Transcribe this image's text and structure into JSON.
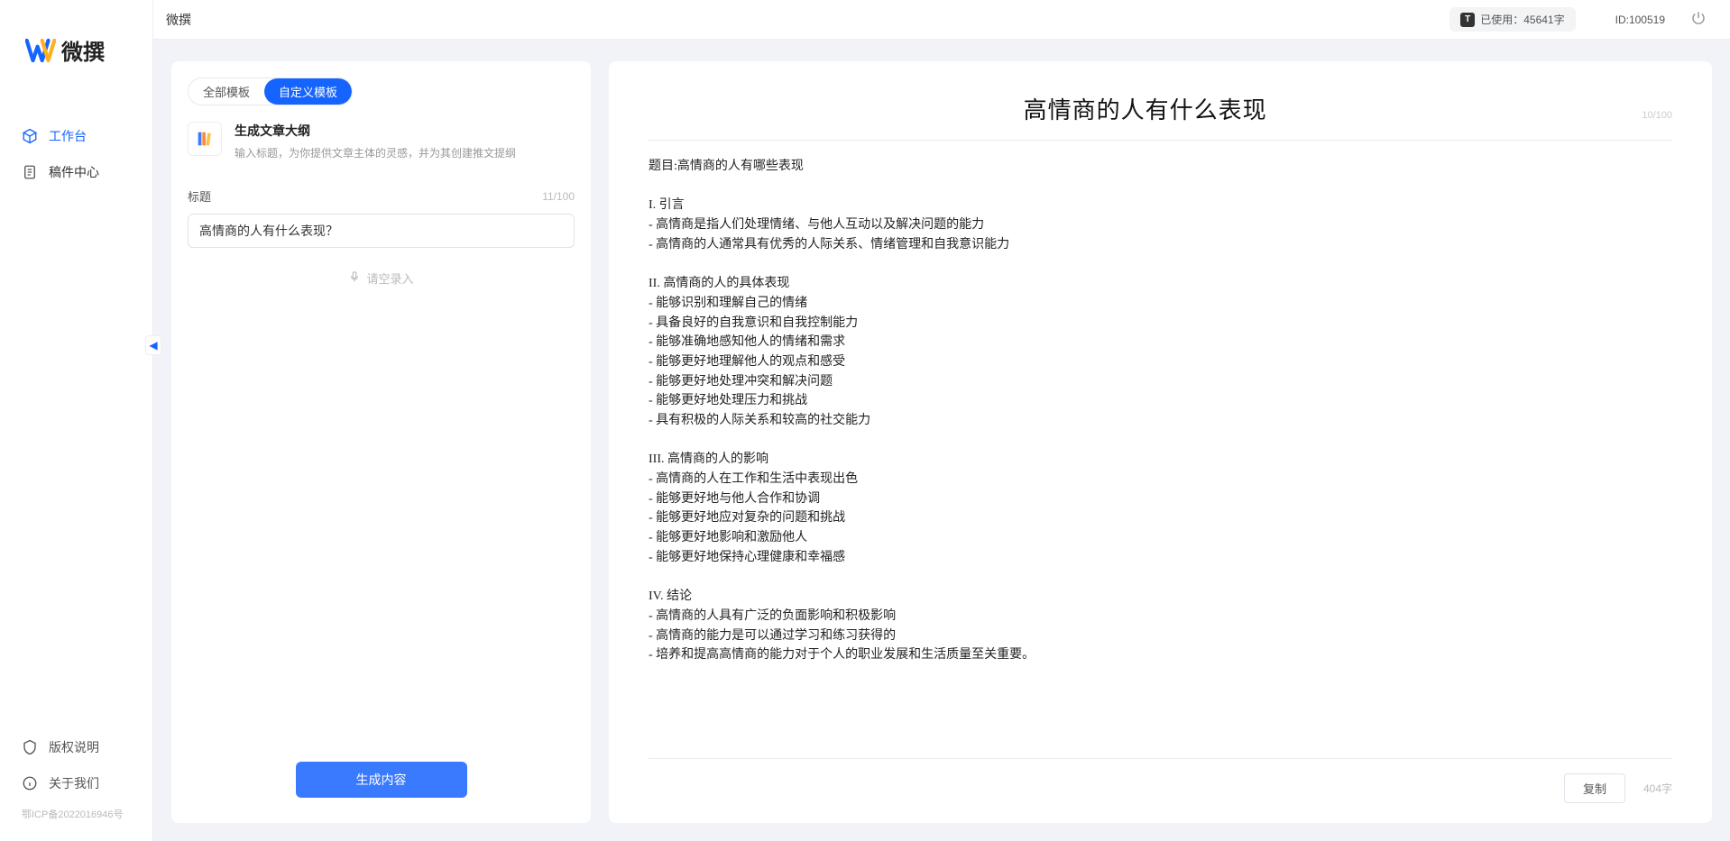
{
  "brand": {
    "name": "微撰"
  },
  "topbar": {
    "app_name": "微撰",
    "usage_label": "已使用：45641字",
    "user_id": "ID:100519"
  },
  "sidebar": {
    "nav": [
      {
        "key": "workbench",
        "label": "工作台",
        "active": true
      },
      {
        "key": "drafts",
        "label": "稿件中心",
        "active": false
      }
    ],
    "bottom": [
      {
        "key": "copyright",
        "label": "版权说明"
      },
      {
        "key": "about",
        "label": "关于我们"
      }
    ],
    "icp": "鄂ICP备2022016946号"
  },
  "tabs": {
    "all": "全部模板",
    "custom": "自定义模板"
  },
  "template": {
    "title": "生成文章大纲",
    "desc": "输入标题，为你提供文章主体的灵感，并为其创建推文提纲"
  },
  "form": {
    "title_label": "标题",
    "title_value": "高情商的人有什么表现？",
    "title_count": "11/100",
    "voice_hint": "请空录入"
  },
  "actions": {
    "generate": "生成内容",
    "copy": "复制"
  },
  "output": {
    "title": "高情商的人有什么表现",
    "title_count": "10/100",
    "word_count": "404字",
    "body": "题目:高情商的人有哪些表现\n\nI. 引言\n- 高情商是指人们处理情绪、与他人互动以及解决问题的能力\n- 高情商的人通常具有优秀的人际关系、情绪管理和自我意识能力\n\nII. 高情商的人的具体表现\n- 能够识别和理解自己的情绪\n- 具备良好的自我意识和自我控制能力\n- 能够准确地感知他人的情绪和需求\n- 能够更好地理解他人的观点和感受\n- 能够更好地处理冲突和解决问题\n- 能够更好地处理压力和挑战\n- 具有积极的人际关系和较高的社交能力\n\nIII. 高情商的人的影响\n- 高情商的人在工作和生活中表现出色\n- 能够更好地与他人合作和协调\n- 能够更好地应对复杂的问题和挑战\n- 能够更好地影响和激励他人\n- 能够更好地保持心理健康和幸福感\n\nIV. 结论\n- 高情商的人具有广泛的负面影响和积极影响\n- 高情商的能力是可以通过学习和练习获得的\n- 培养和提高高情商的能力对于个人的职业发展和生活质量至关重要。"
  }
}
